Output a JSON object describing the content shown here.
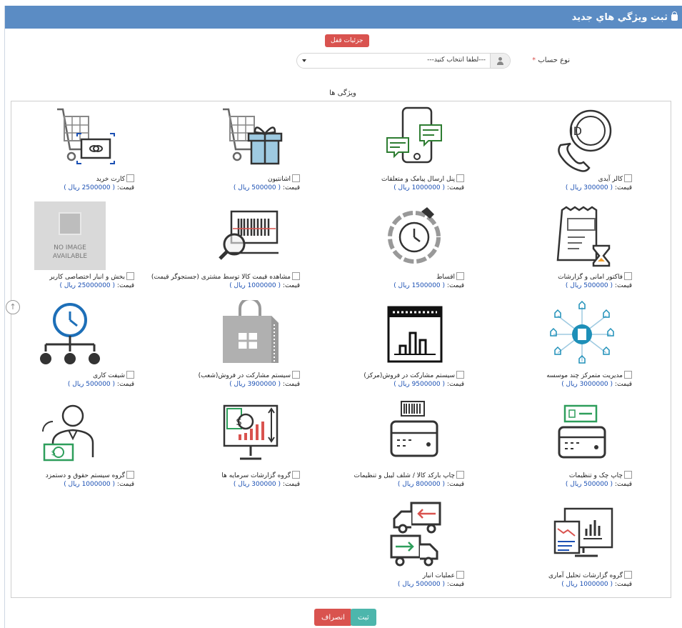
{
  "header": {
    "title": "ثبت ويژگي هاي جديد",
    "icon": "lock-icon"
  },
  "lock_details_button": "جزئیات قفل",
  "account": {
    "label": "نوع حساب",
    "required_mark": "*",
    "selected": "---لطفا انتخاب کنید---"
  },
  "features_title": "ویژگی ها",
  "price_label": "قیمت:",
  "features": [
    {
      "name": "کالر آیدی",
      "price": "( 300000 ریال )",
      "icon": "caller-id-phone-icon"
    },
    {
      "name": "پنل ارسال پیامک و متعلقات",
      "price": "( 1000000 ریال )",
      "icon": "sms-panel-phone-icon"
    },
    {
      "name": "اشانتیون",
      "price": "( 500000 ریال )",
      "icon": "gift-cart-icon"
    },
    {
      "name": "کارت خرید",
      "price": "( 2500000 ریال )",
      "icon": "shopping-card-cart-icon"
    },
    {
      "name": "فاکتور امانی و گزارشات",
      "price": "( 500000 ریال )",
      "icon": "invoice-hourglass-icon"
    },
    {
      "name": "اقساط",
      "price": "( 1500000 ریال )",
      "icon": "installment-clock-icon"
    },
    {
      "name": "مشاهده قیمت کالا توسط مشتری (جستجوگر قیمت)",
      "price": "( 1000000 ریال )",
      "icon": "price-checker-icon"
    },
    {
      "name": "بخش و انبار اختصاصی کاربر",
      "price": "( 25000000 ریال )",
      "icon": "no-image-placeholder",
      "no_image_text_1": "NO IMAGE",
      "no_image_text_2": "AVAILABLE"
    },
    {
      "name": "مدیریت متمرکز چند موسسه",
      "price": "( 3000000 ریال )",
      "icon": "central-management-network-icon"
    },
    {
      "name": "سیستم مشارکت در فروش(مرکز)",
      "price": "( 9500000 ریال )",
      "icon": "sales-partnership-center-icon"
    },
    {
      "name": "سیستم مشارکت در فروش(شعب)",
      "price": "( 3900000 ریال )",
      "icon": "sales-partnership-branch-icon"
    },
    {
      "name": "شیفت کاری",
      "price": "( 500000 ریال )",
      "icon": "work-shift-clock-icon"
    },
    {
      "name": "چاپ چک و تنظیمات",
      "price": "( 500000 ریال )",
      "icon": "check-printer-icon"
    },
    {
      "name": "چاپ بارکد کالا / شلف لیبل و تنظیمات",
      "price": "( 800000 ریال )",
      "icon": "barcode-printer-icon"
    },
    {
      "name": "گروه گزارشات سرمایه ها",
      "price": "( 300000 ریال )",
      "icon": "capital-report-icon"
    },
    {
      "name": "گروه سیستم حقوق و دستمزد",
      "price": "( 1000000 ریال )",
      "icon": "payroll-icon"
    },
    {
      "name": "گروه گزارشات تحلیل آماری",
      "price": "( 1000000 ریال )",
      "icon": "statistical-report-icon"
    },
    {
      "name": "عملیات انبار",
      "price": "( 500000 ریال )",
      "icon": "warehouse-trucks-icon"
    }
  ],
  "buttons": {
    "submit": "ثبت",
    "cancel": "انصراف"
  },
  "colors": {
    "header": "#5b8cc4",
    "danger": "#d9534f",
    "success": "#4db6ac",
    "price": "#1a4fb3"
  }
}
